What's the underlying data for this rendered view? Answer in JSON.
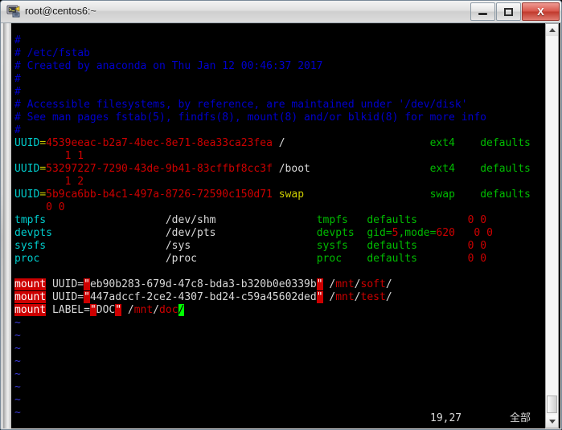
{
  "window": {
    "title": "root@centos6:~",
    "icon": "putty-terminal-icon",
    "controls": {
      "minimize_label": "—",
      "maximize_label": "□",
      "close_label": "X"
    }
  },
  "colors": {
    "comment": "#0000cd",
    "cyan": "#00cdcd",
    "green": "#00bb00",
    "red": "#cd0000",
    "yellow": "#cdcd00",
    "white": "#d8d8d8",
    "tilde": "#3b3bdd",
    "cursor": "#00ff00",
    "background": "#000000",
    "close_button": "#c0392c"
  },
  "editor": {
    "lines": [
      {
        "n": 1,
        "segs": [
          {
            "t": "#",
            "c": "cmt"
          }
        ]
      },
      {
        "n": 2,
        "segs": [
          {
            "t": "# /etc/fstab",
            "c": "cmt"
          }
        ]
      },
      {
        "n": 3,
        "segs": [
          {
            "t": "# Created by anaconda on Thu Jan 12 00:46:37 2017",
            "c": "cmt"
          }
        ]
      },
      {
        "n": 4,
        "segs": [
          {
            "t": "#",
            "c": "cmt"
          }
        ]
      },
      {
        "n": 5,
        "segs": [
          {
            "t": "#",
            "c": "cmt"
          }
        ]
      },
      {
        "n": 6,
        "segs": [
          {
            "t": "# Accessible filesystems, by reference, are maintained under '/dev/disk'",
            "c": "cmt"
          }
        ]
      },
      {
        "n": 7,
        "segs": [
          {
            "t": "# See man pages fstab(5), findfs(8), mount(8) and/or blkid(8) for more info",
            "c": "cmt"
          }
        ]
      },
      {
        "n": 8,
        "segs": [
          {
            "t": "#",
            "c": "cmt"
          }
        ]
      },
      {
        "n": 9,
        "segs": [
          {
            "t": "UUID",
            "c": "cyan"
          },
          {
            "t": "=",
            "c": "yel"
          },
          {
            "t": "4539eeac-b2a7-4bec-8e71-8ea33ca23fea ",
            "c": "red"
          },
          {
            "t": "/",
            "c": "wht"
          },
          {
            "t": "                       ",
            "c": "wht"
          },
          {
            "t": "ext4",
            "c": "grn"
          },
          {
            "t": "    ",
            "c": "wht"
          },
          {
            "t": "defaults",
            "c": "grn"
          }
        ]
      },
      {
        "n": 10,
        "segs": [
          {
            "t": "        1 1",
            "c": "red"
          }
        ]
      },
      {
        "n": 11,
        "segs": [
          {
            "t": "UUID",
            "c": "cyan"
          },
          {
            "t": "=",
            "c": "yel"
          },
          {
            "t": "53297227-7290-43de-9b41-83cffbf8cc3f ",
            "c": "red"
          },
          {
            "t": "/boot",
            "c": "wht"
          },
          {
            "t": "                   ",
            "c": "wht"
          },
          {
            "t": "ext4",
            "c": "grn"
          },
          {
            "t": "    ",
            "c": "wht"
          },
          {
            "t": "defaults",
            "c": "grn"
          }
        ]
      },
      {
        "n": 12,
        "segs": [
          {
            "t": "        1 2",
            "c": "red"
          }
        ]
      },
      {
        "n": 13,
        "segs": [
          {
            "t": "UUID",
            "c": "cyan"
          },
          {
            "t": "=",
            "c": "yel"
          },
          {
            "t": "5b9ca6bb-b4c1-497a-8726-72590c150d71 ",
            "c": "red"
          },
          {
            "t": "swap",
            "c": "yel"
          },
          {
            "t": "                    ",
            "c": "wht"
          },
          {
            "t": "swap",
            "c": "grn"
          },
          {
            "t": "    ",
            "c": "wht"
          },
          {
            "t": "defaults",
            "c": "grn"
          }
        ]
      },
      {
        "n": 14,
        "segs": [
          {
            "t": "     0 0",
            "c": "red"
          }
        ]
      },
      {
        "n": 15,
        "segs": [
          {
            "t": "tmpfs",
            "c": "cyan"
          },
          {
            "t": "                   ",
            "c": "wht"
          },
          {
            "t": "/dev/shm",
            "c": "wht"
          },
          {
            "t": "                ",
            "c": "wht"
          },
          {
            "t": "tmpfs",
            "c": "grn"
          },
          {
            "t": "   ",
            "c": "wht"
          },
          {
            "t": "defaults",
            "c": "grn"
          },
          {
            "t": "        ",
            "c": "wht"
          },
          {
            "t": "0 0",
            "c": "red"
          }
        ]
      },
      {
        "n": 16,
        "segs": [
          {
            "t": "devpts",
            "c": "cyan"
          },
          {
            "t": "                  ",
            "c": "wht"
          },
          {
            "t": "/dev/pts",
            "c": "wht"
          },
          {
            "t": "                ",
            "c": "wht"
          },
          {
            "t": "devpts",
            "c": "grn"
          },
          {
            "t": "  ",
            "c": "wht"
          },
          {
            "t": "gid=",
            "c": "grn"
          },
          {
            "t": "5",
            "c": "red"
          },
          {
            "t": ",mode=",
            "c": "grn"
          },
          {
            "t": "620",
            "c": "red"
          },
          {
            "t": "   ",
            "c": "wht"
          },
          {
            "t": "0 0",
            "c": "red"
          }
        ]
      },
      {
        "n": 17,
        "segs": [
          {
            "t": "sysfs",
            "c": "cyan"
          },
          {
            "t": "                   ",
            "c": "wht"
          },
          {
            "t": "/sys",
            "c": "wht"
          },
          {
            "t": "                    ",
            "c": "wht"
          },
          {
            "t": "sysfs",
            "c": "grn"
          },
          {
            "t": "   ",
            "c": "wht"
          },
          {
            "t": "defaults",
            "c": "grn"
          },
          {
            "t": "        ",
            "c": "wht"
          },
          {
            "t": "0 0",
            "c": "red"
          }
        ]
      },
      {
        "n": 18,
        "segs": [
          {
            "t": "proc",
            "c": "cyan"
          },
          {
            "t": "                    ",
            "c": "wht"
          },
          {
            "t": "/proc",
            "c": "wht"
          },
          {
            "t": "                   ",
            "c": "wht"
          },
          {
            "t": "proc",
            "c": "grn"
          },
          {
            "t": "    ",
            "c": "wht"
          },
          {
            "t": "defaults",
            "c": "grn"
          },
          {
            "t": "        ",
            "c": "wht"
          },
          {
            "t": "0 0",
            "c": "red"
          }
        ]
      },
      {
        "n": 19,
        "segs": []
      },
      {
        "n": 20,
        "segs": [
          {
            "t": "mount",
            "c": "hl"
          },
          {
            "t": " UUID=",
            "c": "wht"
          },
          {
            "t": "\"",
            "c": "hlq"
          },
          {
            "t": "eb90b283-679d-47c8-bda3-b320b0e0339b",
            "c": "wht"
          },
          {
            "t": "\"",
            "c": "hlq"
          },
          {
            "t": " /",
            "c": "wht"
          },
          {
            "t": "mnt",
            "c": "red"
          },
          {
            "t": "/",
            "c": "wht"
          },
          {
            "t": "soft",
            "c": "red"
          },
          {
            "t": "/",
            "c": "wht"
          }
        ]
      },
      {
        "n": 21,
        "segs": [
          {
            "t": "mount",
            "c": "hl"
          },
          {
            "t": " UUID=",
            "c": "wht"
          },
          {
            "t": "\"",
            "c": "hlq"
          },
          {
            "t": "447adccf-2ce2-4307-bd24-c59a45602ded",
            "c": "wht"
          },
          {
            "t": "\"",
            "c": "hlq"
          },
          {
            "t": " /",
            "c": "wht"
          },
          {
            "t": "mnt",
            "c": "red"
          },
          {
            "t": "/",
            "c": "wht"
          },
          {
            "t": "test",
            "c": "red"
          },
          {
            "t": "/",
            "c": "wht"
          }
        ]
      },
      {
        "n": 22,
        "segs": [
          {
            "t": "mount",
            "c": "hl"
          },
          {
            "t": " LABEL=",
            "c": "wht"
          },
          {
            "t": "\"",
            "c": "hlq"
          },
          {
            "t": "DOC",
            "c": "wht"
          },
          {
            "t": "\"",
            "c": "hlq"
          },
          {
            "t": " /",
            "c": "wht"
          },
          {
            "t": "mnt",
            "c": "red"
          },
          {
            "t": "/",
            "c": "wht"
          },
          {
            "t": "doc",
            "c": "red"
          },
          {
            "t": "/",
            "c": "cursor"
          }
        ]
      }
    ],
    "empty_marker": "~",
    "empty_marker_count": 8
  },
  "statusline": {
    "position": "19,27",
    "scroll_indicator": "全部"
  },
  "scrollbar": {
    "up_arrow": "scroll-up-arrow-icon",
    "down_arrow": "scroll-down-arrow-icon",
    "thumb": "scroll-thumb"
  }
}
